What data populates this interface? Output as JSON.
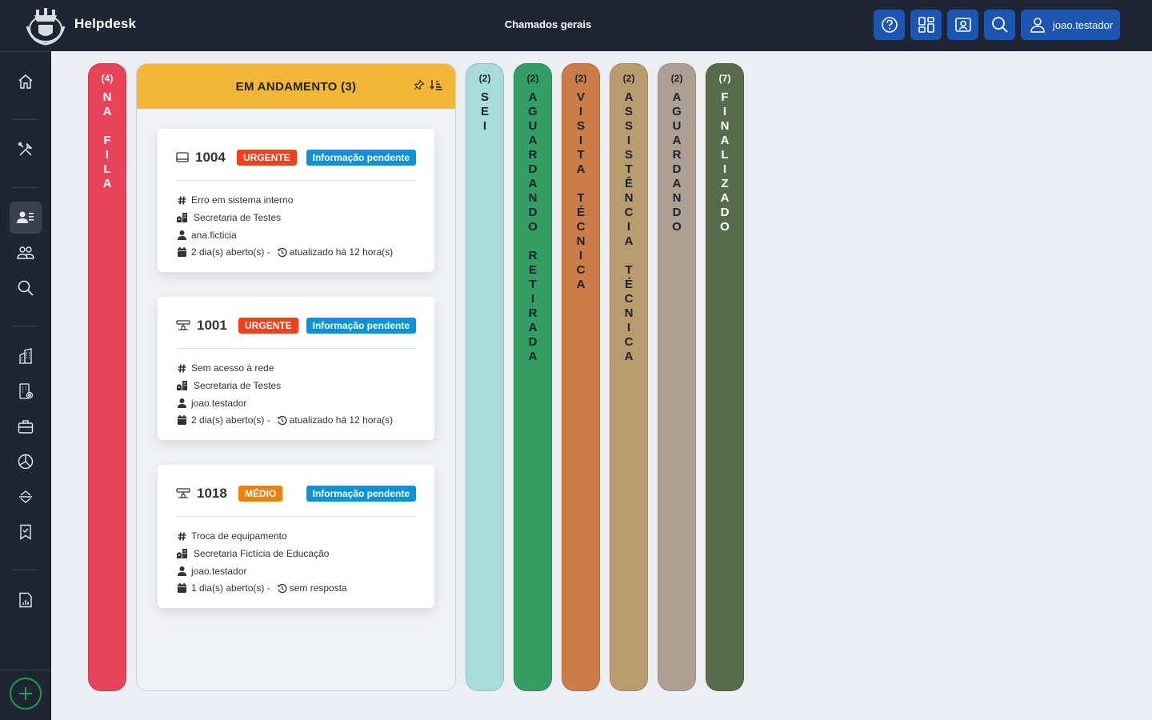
{
  "app": {
    "brand": "Helpdesk",
    "page_title": "Chamados gerais"
  },
  "topbar": {
    "buttons": [
      {
        "name": "help-button",
        "icon": "question-circle-icon"
      },
      {
        "name": "dashboard-button",
        "icon": "grid-icon"
      },
      {
        "name": "profile-card-button",
        "icon": "person-badge-icon"
      },
      {
        "name": "search-button",
        "icon": "search-icon"
      }
    ],
    "user": "joao.testador"
  },
  "colors": {
    "topbar": "#1f2533",
    "accent": "#1c56b0",
    "urgent": "#f0411f",
    "medium": "#ec7f10",
    "info": "#0c92d6",
    "in_progress": "#f2b638"
  },
  "columns_left": [
    {
      "count": "(4)",
      "label": "NA FILA",
      "color": "#e5445a",
      "text_color": "#ffffff"
    }
  ],
  "main_column": {
    "title": "EM ANDAMENTO (3)",
    "icons": [
      "pin-icon",
      "sort-icon"
    ],
    "cards": [
      {
        "icon": "monitor-icon",
        "number": "1004",
        "priority": "URGENTE",
        "priority_color": "#f0411f",
        "status": "Informação pendente",
        "subject": "Erro em sistema interno",
        "department": "Secretaria de Testes",
        "user": "ana.ficticia",
        "opened": "2 dia(s) aberto(s) -",
        "updated": "atualizado há 12 hora(s)"
      },
      {
        "icon": "network-icon",
        "number": "1001",
        "priority": "URGENTE",
        "priority_color": "#f0411f",
        "status": "Informação pendente",
        "subject": "Sem acesso à rede",
        "department": "Secretaria de Testes",
        "user": "joao.testador",
        "opened": "2 dia(s) aberto(s) -",
        "updated": "atualizado há 12 hora(s)"
      },
      {
        "icon": "network-icon",
        "number": "1018",
        "priority": "MÉDIO",
        "priority_color": "#ec7f10",
        "status": "Informação pendente",
        "subject": "Troca de equipamento",
        "department": "Secretaria Fictícia de Educação",
        "user": "joao.testador",
        "opened": "1 dia(s) aberto(s) -",
        "updated": "sem resposta"
      }
    ]
  },
  "columns_right": [
    {
      "count": "(2)",
      "label": "SEI",
      "color": "#a8dcd8",
      "text_color": "#1b2230"
    },
    {
      "count": "(2)",
      "label": "AGUARDANDO RETIRADA",
      "color": "#339d63",
      "text_color": "#1b2230"
    },
    {
      "count": "(2)",
      "label": "VISITA TÉCNICA",
      "color": "#cc7c48",
      "text_color": "#1b2230"
    },
    {
      "count": "(2)",
      "label": "ASSISTÊNCIA TÉCNICA",
      "color": "#b89c6e",
      "text_color": "#1b2230"
    },
    {
      "count": "(2)",
      "label": "AGUARDANDO",
      "color": "#ada093",
      "text_color": "#1b2230"
    },
    {
      "count": "(7)",
      "label": "FINALIZADO",
      "color": "#586b4b",
      "text_color": "#ffffff"
    }
  ],
  "sidebar": {
    "items": [
      {
        "name": "home",
        "icon": "home-icon"
      },
      {
        "name": "tools",
        "icon": "tools-icon"
      },
      {
        "name": "tickets",
        "icon": "person-lines-icon",
        "active": true
      },
      {
        "name": "users",
        "icon": "people-icon"
      },
      {
        "name": "search",
        "icon": "search-icon"
      },
      {
        "name": "buildings",
        "icon": "building-icon"
      },
      {
        "name": "building-settings",
        "icon": "building-gear-icon"
      },
      {
        "name": "briefcase",
        "icon": "briefcase-icon"
      },
      {
        "name": "reports-pie",
        "icon": "pie-chart-icon"
      },
      {
        "name": "sort",
        "icon": "chevron-expand-icon"
      },
      {
        "name": "bookmark-check",
        "icon": "bookmark-check-icon"
      },
      {
        "name": "bar-report",
        "icon": "file-bar-chart-icon"
      }
    ],
    "add": {
      "name": "new-ticket",
      "icon": "plus-circle-icon"
    }
  }
}
